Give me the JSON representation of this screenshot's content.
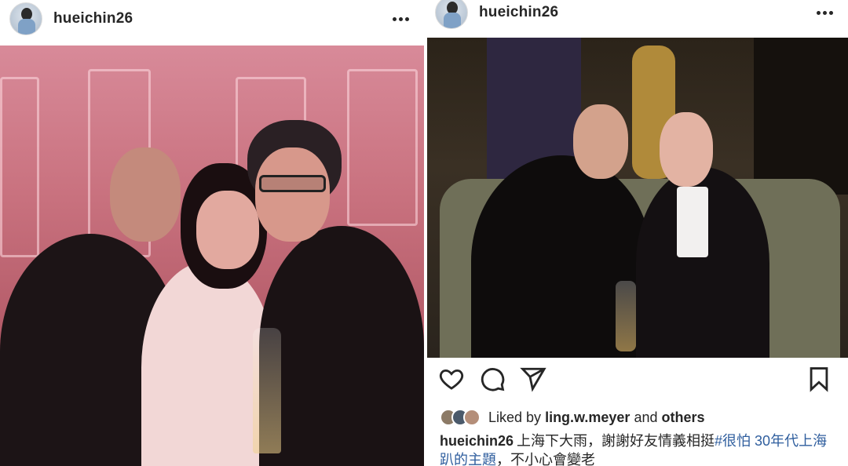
{
  "posts": [
    {
      "username": "hueichin26"
    },
    {
      "username": "hueichin26",
      "liked_by_prefix": "Liked by",
      "liked_by_user": "ling.w.meyer",
      "liked_by_and": "and",
      "liked_by_others": "others",
      "caption_user": "hueichin26",
      "caption_text": "上海下大雨，謝謝好友情義相挺",
      "caption_hashtag": "#很怕 30年代上海趴的主題",
      "caption_tail": "，不小心會變老",
      "icons": [
        "heart-icon",
        "comment-icon",
        "share-icon",
        "bookmark-icon"
      ]
    }
  ],
  "colors": {
    "hashtag": "#2f5e9e",
    "text": "#262626"
  }
}
